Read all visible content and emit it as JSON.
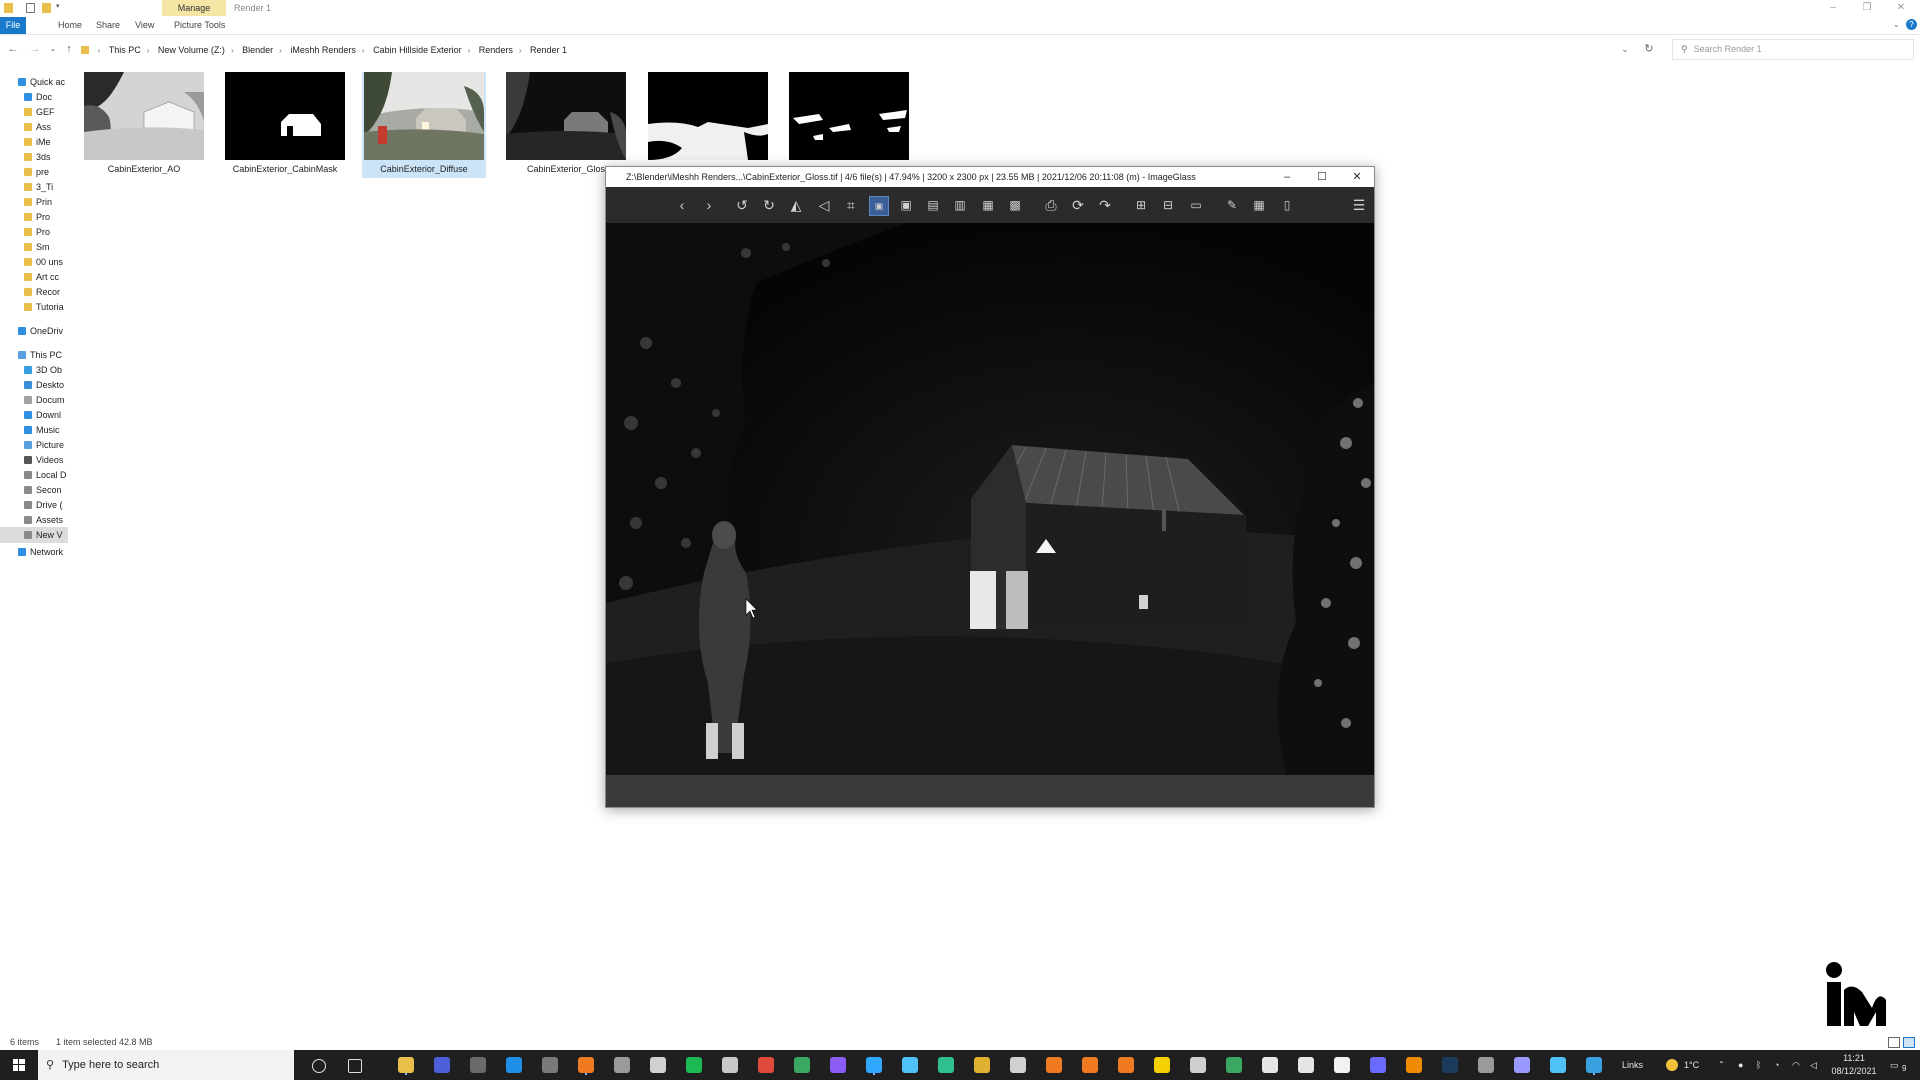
{
  "explorer": {
    "title": "Render 1",
    "context_tab": "Manage",
    "ribbon_tabs": [
      "File",
      "Home",
      "Share",
      "View",
      "Picture Tools"
    ],
    "address": {
      "crumbs": [
        "This PC",
        "New Volume (Z:)",
        "Blender",
        "iMeshh Renders",
        "Cabin Hillside Exterior",
        "Renders",
        "Render 1"
      ]
    },
    "search_placeholder": "Search Render 1",
    "nav_pane": [
      {
        "label": "Quick ac",
        "icon": "star-icon",
        "color": "#2f8fe0"
      },
      {
        "label": "Doc",
        "icon": "download-icon",
        "color": "#2f8fe0"
      },
      {
        "label": "GEF",
        "icon": "folder-icon",
        "color": "#e9bf4a"
      },
      {
        "label": "Ass",
        "icon": "folder-icon",
        "color": "#e9bf4a"
      },
      {
        "label": "iMe",
        "icon": "folder-icon",
        "color": "#e9bf4a"
      },
      {
        "label": "3ds",
        "icon": "folder-icon",
        "color": "#e9bf4a"
      },
      {
        "label": "pre",
        "icon": "folder-icon",
        "color": "#e9bf4a"
      },
      {
        "label": "3_Ti",
        "icon": "folder-icon",
        "color": "#e9bf4a"
      },
      {
        "label": "Prin",
        "icon": "folder-icon",
        "color": "#e9bf4a"
      },
      {
        "label": "Pro",
        "icon": "folder-icon",
        "color": "#e9bf4a"
      },
      {
        "label": "Pro",
        "icon": "folder-icon",
        "color": "#e9bf4a"
      },
      {
        "label": "Sm",
        "icon": "folder-icon",
        "color": "#e9bf4a"
      },
      {
        "label": "00 uns",
        "icon": "folder-icon",
        "color": "#e9bf4a"
      },
      {
        "label": "Art cc",
        "icon": "folder-icon",
        "color": "#e9bf4a"
      },
      {
        "label": "Recor",
        "icon": "folder-icon",
        "color": "#e9bf4a"
      },
      {
        "label": "Tutoria",
        "icon": "folder-icon",
        "color": "#e9bf4a"
      },
      {
        "label": "OneDriv",
        "icon": "cloud-icon",
        "color": "#2f8fe0"
      },
      {
        "label": "This PC",
        "icon": "computer-icon",
        "color": "#5aa0e0"
      },
      {
        "label": "3D Ob",
        "icon": "cube-icon",
        "color": "#38a0e0"
      },
      {
        "label": "Deskto",
        "icon": "desktop-icon",
        "color": "#3a8fd8"
      },
      {
        "label": "Docum",
        "icon": "document-icon",
        "color": "#a0a0a0"
      },
      {
        "label": "Downl",
        "icon": "download-icon",
        "color": "#2f8fe0"
      },
      {
        "label": "Music",
        "icon": "music-icon",
        "color": "#2f8fe0"
      },
      {
        "label": "Picture",
        "icon": "picture-icon",
        "color": "#5aa0e0"
      },
      {
        "label": "Videos",
        "icon": "video-icon",
        "color": "#555555"
      },
      {
        "label": "Local D",
        "icon": "drive-icon",
        "color": "#8a8a8a"
      },
      {
        "label": "Secon",
        "icon": "drive-icon",
        "color": "#8a8a8a"
      },
      {
        "label": "Drive (",
        "icon": "drive-icon",
        "color": "#8a8a8a"
      },
      {
        "label": "Assets",
        "icon": "drive-icon",
        "color": "#8a8a8a"
      },
      {
        "label": "New V",
        "icon": "drive-icon",
        "color": "#8a8a8a",
        "selected": true
      },
      {
        "label": "Network",
        "icon": "network-icon",
        "color": "#2f8fe0"
      }
    ],
    "files": [
      {
        "name": "CabinExterior_AO",
        "kind": "ao"
      },
      {
        "name": "CabinExterior_CabinMask",
        "kind": "mask"
      },
      {
        "name": "CabinExterior_Diffuse",
        "kind": "diffuse",
        "selected": true
      },
      {
        "name": "CabinExterior_Glos",
        "kind": "gloss"
      },
      {
        "name": "",
        "kind": "mask2"
      },
      {
        "name": "",
        "kind": "mask3"
      }
    ],
    "status": {
      "items": "6 items",
      "selection": "1 item selected  42.8 MB"
    }
  },
  "imageglass": {
    "title": "Z:\\Blender\\iMeshh Renders...\\CabinExterior_Gloss.tif  |  4/6 file(s)  |  47.94%  |  3200 x 2300 px  |  23.55 MB  |  2021/12/06 20:11:08 (m)  - ImageGlass",
    "zoom_percent": 47.94,
    "file_index": "4/6",
    "toolbar": [
      "prev-icon",
      "next-icon",
      "rotate-left-icon",
      "rotate-right-icon",
      "flip-horizontal-icon",
      "flip-vertical-icon",
      "crop-icon",
      "auto-zoom-icon",
      "lock-zoom-icon",
      "scale-width-icon",
      "scale-height-icon",
      "scale-fit-icon",
      "fill-icon",
      "print-icon",
      "refresh-icon",
      "goto-icon",
      "zoom-in-icon",
      "zoom-out-icon",
      "slideshow-icon",
      "edit-icon",
      "thumbnail-icon",
      "delete-icon",
      "menu-icon"
    ]
  },
  "taskbar": {
    "search_placeholder": "Type here to search",
    "tray_links": "Links",
    "temperature": "1°C",
    "time": "11:21",
    "date": "08/12/2021",
    "notification_count": "9"
  }
}
